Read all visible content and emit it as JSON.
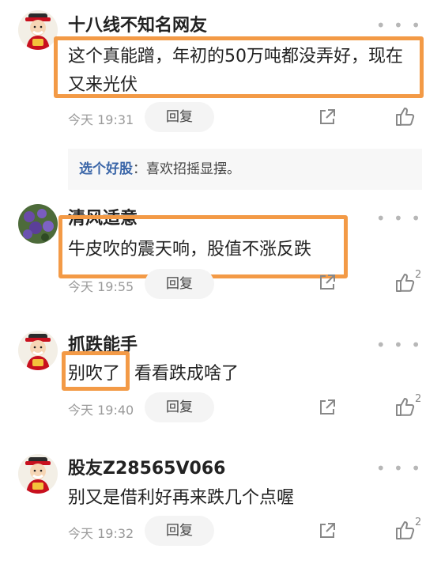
{
  "comments": [
    {
      "username": "十八线不知名网友",
      "text_line1": "这个真能蹭，年初的50万吨都没弄好，现在",
      "text_line2": "又来光伏",
      "time": "今天 19:31",
      "reply_label": "回复",
      "like_count": "",
      "sub_reply": {
        "name": "选个好股",
        "text": "：喜欢招摇显摆。"
      }
    },
    {
      "username": "清风适意",
      "text_line1": "牛皮吹的震天响，股值不涨反跌",
      "time": "今天 19:55",
      "reply_label": "回复",
      "like_count": "2"
    },
    {
      "username": "抓跌能手",
      "text_line1": "别吹了",
      "text_line1b": "看看跌成啥了",
      "time": "今天 19:40",
      "reply_label": "回复",
      "like_count": "2"
    },
    {
      "username": "股友Z28565V066",
      "text_line1": "别又是借利好再来跌几个点喔",
      "time": "今天 19:32",
      "reply_label": "回复",
      "like_count": "2"
    }
  ],
  "more_glyph": "• • •",
  "icons": {
    "avatar_default": "fortune-god-avatar",
    "avatar_2": "purple-flowers-avatar",
    "share": "share-icon",
    "like": "thumbs-up-icon"
  },
  "colors": {
    "highlight": "#f39a46",
    "link_name": "#3b66a8"
  }
}
